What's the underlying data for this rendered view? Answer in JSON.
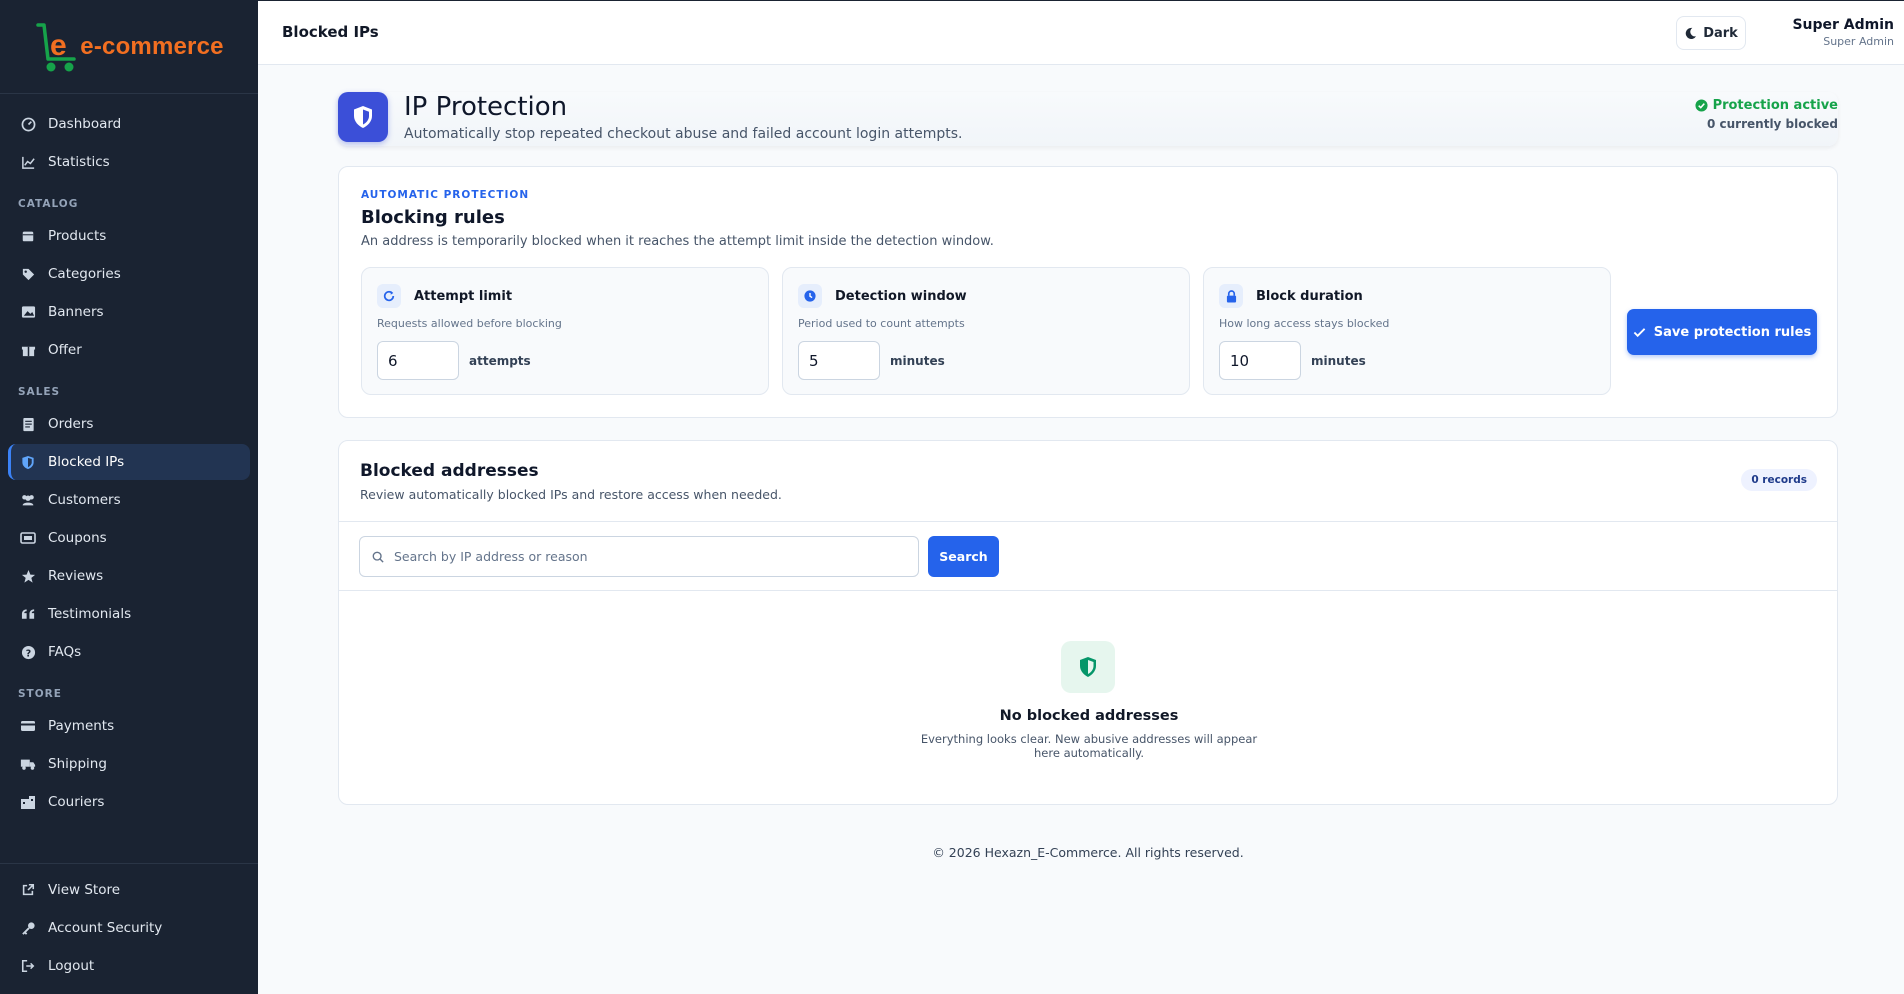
{
  "brand": {
    "logo_text": "e-commerce",
    "logo_color": "#f26f21",
    "cart_color": "#16a34a"
  },
  "sidebar": {
    "items_top": [
      {
        "label": "Dashboard",
        "icon": "dashboard-icon"
      },
      {
        "label": "Statistics",
        "icon": "chart-line-icon"
      }
    ],
    "sections": [
      {
        "title": "CATALOG",
        "items": [
          {
            "label": "Products",
            "icon": "box-icon"
          },
          {
            "label": "Categories",
            "icon": "tags-icon"
          },
          {
            "label": "Banners",
            "icon": "image-icon"
          },
          {
            "label": "Offer",
            "icon": "gift-icon"
          }
        ]
      },
      {
        "title": "SALES",
        "items": [
          {
            "label": "Orders",
            "icon": "receipt-icon"
          },
          {
            "label": "Blocked IPs",
            "icon": "shield-icon",
            "active": true
          },
          {
            "label": "Customers",
            "icon": "users-icon"
          },
          {
            "label": "Coupons",
            "icon": "ticket-icon"
          },
          {
            "label": "Reviews",
            "icon": "star-icon"
          },
          {
            "label": "Testimonials",
            "icon": "quote-icon"
          },
          {
            "label": "FAQs",
            "icon": "question-icon"
          }
        ]
      },
      {
        "title": "STORE",
        "items": [
          {
            "label": "Payments",
            "icon": "credit-card-icon"
          },
          {
            "label": "Shipping",
            "icon": "truck-icon"
          },
          {
            "label": "Couriers",
            "icon": "building-icon"
          }
        ]
      }
    ],
    "bottom": [
      {
        "label": "View Store",
        "icon": "external-link-icon"
      },
      {
        "label": "Account Security",
        "icon": "key-icon"
      },
      {
        "label": "Logout",
        "icon": "logout-icon"
      }
    ]
  },
  "topbar": {
    "title": "Blocked IPs",
    "theme_button": "Dark",
    "user_name": "Super Admin",
    "user_role": "Super Admin"
  },
  "header": {
    "title": "IP Protection",
    "subtitle": "Automatically stop repeated checkout abuse and failed account login attempts.",
    "status": "Protection active",
    "blocked_count": "0 currently blocked"
  },
  "rules": {
    "eyebrow": "AUTOMATIC PROTECTION",
    "title": "Blocking rules",
    "subtitle": "An address is temporarily blocked when it reaches the attempt limit inside the detection window.",
    "items": [
      {
        "title": "Attempt limit",
        "subtitle": "Requests allowed before blocking",
        "value": "6",
        "unit": "attempts"
      },
      {
        "title": "Detection window",
        "subtitle": "Period used to count attempts",
        "value": "5",
        "unit": "minutes"
      },
      {
        "title": "Block duration",
        "subtitle": "How long access stays blocked",
        "value": "10",
        "unit": "minutes"
      }
    ],
    "save_label": "Save protection rules"
  },
  "blocked": {
    "title": "Blocked addresses",
    "subtitle": "Review automatically blocked IPs and restore access when needed.",
    "records": "0 records",
    "search_placeholder": "Search by IP address or reason",
    "search_label": "Search",
    "empty_title": "No blocked addresses",
    "empty_subtitle": "Everything looks clear. New abusive addresses will appear here automatically."
  },
  "footer": {
    "text": "© 2026 Hexazn_E-Commerce. All rights reserved."
  },
  "colors": {
    "primary": "#2563eb",
    "sidebar_bg": "#1a2332",
    "success": "#16a34a"
  }
}
